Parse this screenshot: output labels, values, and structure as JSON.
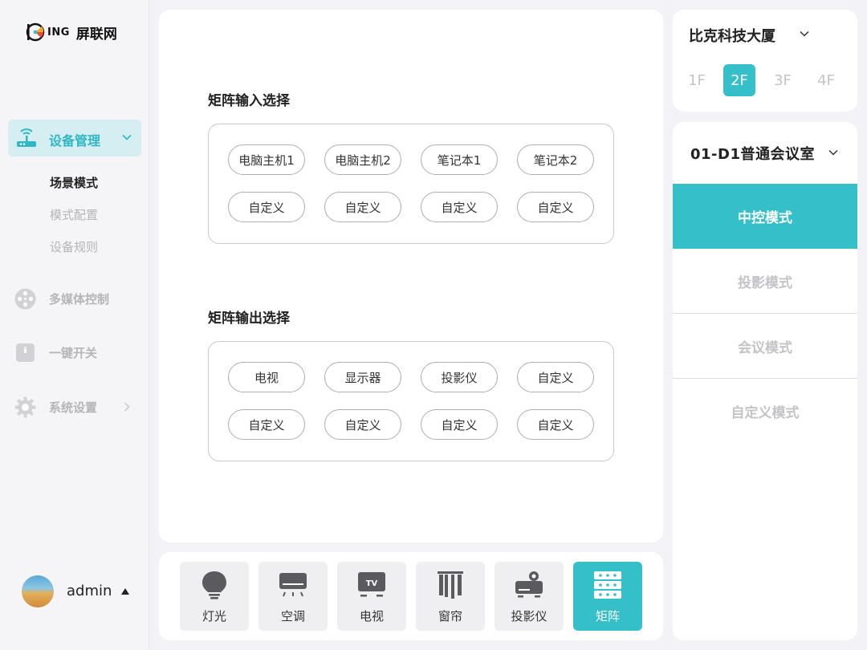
{
  "brand": {
    "mark": "ING",
    "name": "屏联网"
  },
  "sidebar": {
    "active_item": {
      "label": "设备管理",
      "icon": "router-icon"
    },
    "sub_items": [
      {
        "label": "场景模式",
        "active": true
      },
      {
        "label": "模式配置",
        "active": false
      },
      {
        "label": "设备规则",
        "active": false
      }
    ],
    "items": [
      {
        "label": "多媒体控制",
        "icon": "film-reel-icon"
      },
      {
        "label": "一键开关",
        "icon": "switch-icon"
      },
      {
        "label": "系统设置",
        "icon": "gear-icon"
      }
    ],
    "user": {
      "name": "admin"
    }
  },
  "matrix": {
    "input_title": "矩阵输入选择",
    "inputs": [
      "电脑主机1",
      "电脑主机2",
      "笔记本1",
      "笔记本2",
      "自定义",
      "自定义",
      "自定义",
      "自定义"
    ],
    "output_title": "矩阵输出选择",
    "outputs": [
      "电视",
      "显示器",
      "投影仪",
      "自定义",
      "自定义",
      "自定义",
      "自定义",
      "自定义"
    ]
  },
  "devices": [
    {
      "label": "灯光",
      "icon": "bulb-icon",
      "active": false
    },
    {
      "label": "空调",
      "icon": "air-conditioner-icon",
      "active": false
    },
    {
      "label": "电视",
      "icon": "tv-icon",
      "active": false
    },
    {
      "label": "窗帘",
      "icon": "curtain-icon",
      "active": false
    },
    {
      "label": "投影仪",
      "icon": "projector-icon",
      "active": false
    },
    {
      "label": "矩阵",
      "icon": "matrix-icon",
      "active": true
    }
  ],
  "building": {
    "name": "比克科技大厦",
    "floors": [
      "1F",
      "2F",
      "3F",
      "4F"
    ],
    "selected_floor": "2F"
  },
  "room": {
    "name": "01-D1普通会议室",
    "modes": [
      "中控模式",
      "投影模式",
      "会议模式",
      "自定义模式"
    ],
    "selected_mode": "中控模式"
  },
  "colors": {
    "accent": "#34bfc9",
    "accent_light": "#d4eef1",
    "muted": "#c4c4c7"
  }
}
